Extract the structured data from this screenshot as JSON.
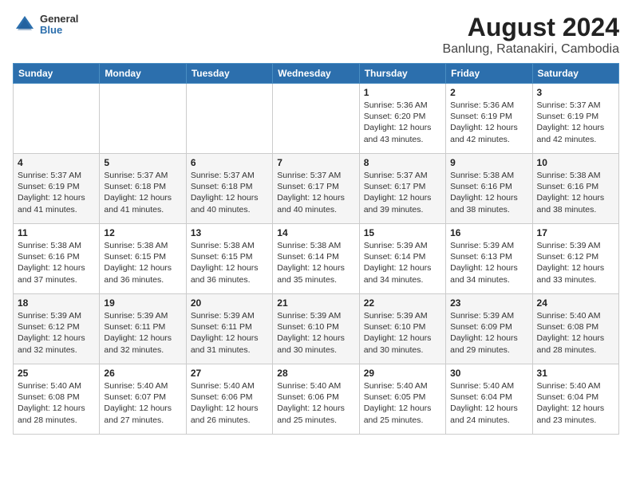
{
  "header": {
    "logo": {
      "general": "General",
      "blue": "Blue"
    },
    "title": "August 2024",
    "subtitle": "Banlung, Ratanakiri, Cambodia"
  },
  "weekdays": [
    "Sunday",
    "Monday",
    "Tuesday",
    "Wednesday",
    "Thursday",
    "Friday",
    "Saturday"
  ],
  "weeks": [
    [
      {
        "day": "",
        "info": ""
      },
      {
        "day": "",
        "info": ""
      },
      {
        "day": "",
        "info": ""
      },
      {
        "day": "",
        "info": ""
      },
      {
        "day": "1",
        "info": "Sunrise: 5:36 AM\nSunset: 6:20 PM\nDaylight: 12 hours\nand 43 minutes."
      },
      {
        "day": "2",
        "info": "Sunrise: 5:36 AM\nSunset: 6:19 PM\nDaylight: 12 hours\nand 42 minutes."
      },
      {
        "day": "3",
        "info": "Sunrise: 5:37 AM\nSunset: 6:19 PM\nDaylight: 12 hours\nand 42 minutes."
      }
    ],
    [
      {
        "day": "4",
        "info": "Sunrise: 5:37 AM\nSunset: 6:19 PM\nDaylight: 12 hours\nand 41 minutes."
      },
      {
        "day": "5",
        "info": "Sunrise: 5:37 AM\nSunset: 6:18 PM\nDaylight: 12 hours\nand 41 minutes."
      },
      {
        "day": "6",
        "info": "Sunrise: 5:37 AM\nSunset: 6:18 PM\nDaylight: 12 hours\nand 40 minutes."
      },
      {
        "day": "7",
        "info": "Sunrise: 5:37 AM\nSunset: 6:17 PM\nDaylight: 12 hours\nand 40 minutes."
      },
      {
        "day": "8",
        "info": "Sunrise: 5:37 AM\nSunset: 6:17 PM\nDaylight: 12 hours\nand 39 minutes."
      },
      {
        "day": "9",
        "info": "Sunrise: 5:38 AM\nSunset: 6:16 PM\nDaylight: 12 hours\nand 38 minutes."
      },
      {
        "day": "10",
        "info": "Sunrise: 5:38 AM\nSunset: 6:16 PM\nDaylight: 12 hours\nand 38 minutes."
      }
    ],
    [
      {
        "day": "11",
        "info": "Sunrise: 5:38 AM\nSunset: 6:16 PM\nDaylight: 12 hours\nand 37 minutes."
      },
      {
        "day": "12",
        "info": "Sunrise: 5:38 AM\nSunset: 6:15 PM\nDaylight: 12 hours\nand 36 minutes."
      },
      {
        "day": "13",
        "info": "Sunrise: 5:38 AM\nSunset: 6:15 PM\nDaylight: 12 hours\nand 36 minutes."
      },
      {
        "day": "14",
        "info": "Sunrise: 5:38 AM\nSunset: 6:14 PM\nDaylight: 12 hours\nand 35 minutes."
      },
      {
        "day": "15",
        "info": "Sunrise: 5:39 AM\nSunset: 6:14 PM\nDaylight: 12 hours\nand 34 minutes."
      },
      {
        "day": "16",
        "info": "Sunrise: 5:39 AM\nSunset: 6:13 PM\nDaylight: 12 hours\nand 34 minutes."
      },
      {
        "day": "17",
        "info": "Sunrise: 5:39 AM\nSunset: 6:12 PM\nDaylight: 12 hours\nand 33 minutes."
      }
    ],
    [
      {
        "day": "18",
        "info": "Sunrise: 5:39 AM\nSunset: 6:12 PM\nDaylight: 12 hours\nand 32 minutes."
      },
      {
        "day": "19",
        "info": "Sunrise: 5:39 AM\nSunset: 6:11 PM\nDaylight: 12 hours\nand 32 minutes."
      },
      {
        "day": "20",
        "info": "Sunrise: 5:39 AM\nSunset: 6:11 PM\nDaylight: 12 hours\nand 31 minutes."
      },
      {
        "day": "21",
        "info": "Sunrise: 5:39 AM\nSunset: 6:10 PM\nDaylight: 12 hours\nand 30 minutes."
      },
      {
        "day": "22",
        "info": "Sunrise: 5:39 AM\nSunset: 6:10 PM\nDaylight: 12 hours\nand 30 minutes."
      },
      {
        "day": "23",
        "info": "Sunrise: 5:39 AM\nSunset: 6:09 PM\nDaylight: 12 hours\nand 29 minutes."
      },
      {
        "day": "24",
        "info": "Sunrise: 5:40 AM\nSunset: 6:08 PM\nDaylight: 12 hours\nand 28 minutes."
      }
    ],
    [
      {
        "day": "25",
        "info": "Sunrise: 5:40 AM\nSunset: 6:08 PM\nDaylight: 12 hours\nand 28 minutes."
      },
      {
        "day": "26",
        "info": "Sunrise: 5:40 AM\nSunset: 6:07 PM\nDaylight: 12 hours\nand 27 minutes."
      },
      {
        "day": "27",
        "info": "Sunrise: 5:40 AM\nSunset: 6:06 PM\nDaylight: 12 hours\nand 26 minutes."
      },
      {
        "day": "28",
        "info": "Sunrise: 5:40 AM\nSunset: 6:06 PM\nDaylight: 12 hours\nand 25 minutes."
      },
      {
        "day": "29",
        "info": "Sunrise: 5:40 AM\nSunset: 6:05 PM\nDaylight: 12 hours\nand 25 minutes."
      },
      {
        "day": "30",
        "info": "Sunrise: 5:40 AM\nSunset: 6:04 PM\nDaylight: 12 hours\nand 24 minutes."
      },
      {
        "day": "31",
        "info": "Sunrise: 5:40 AM\nSunset: 6:04 PM\nDaylight: 12 hours\nand 23 minutes."
      }
    ]
  ]
}
